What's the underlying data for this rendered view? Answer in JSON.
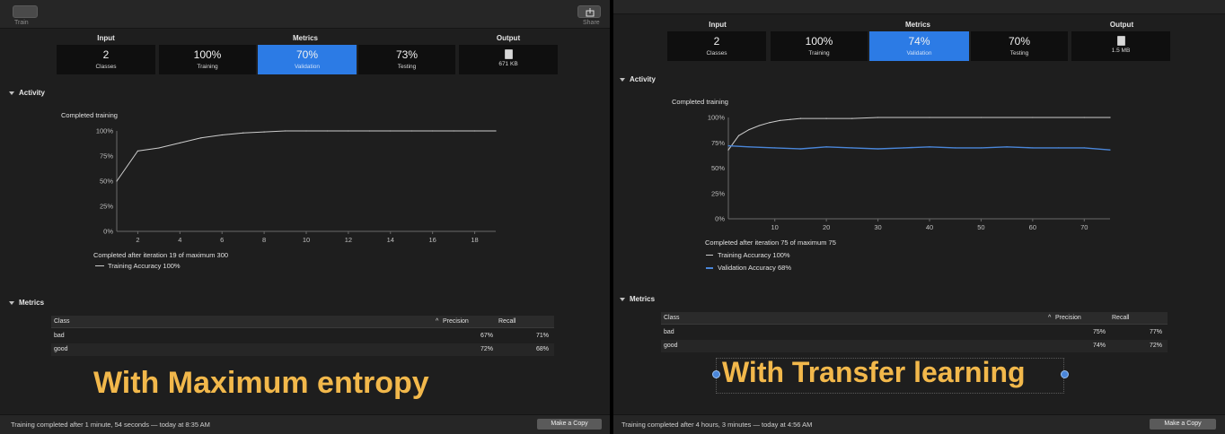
{
  "left": {
    "toolbar": {
      "train_label": "Train",
      "share_label": "Share"
    },
    "groups": {
      "input": "Input",
      "metrics": "Metrics",
      "output": "Output"
    },
    "tiles": {
      "classes": {
        "value": "2",
        "label": "Classes"
      },
      "training": {
        "value": "100%",
        "label": "Training"
      },
      "validation": {
        "value": "70%",
        "label": "Validation"
      },
      "testing": {
        "value": "73%",
        "label": "Testing"
      },
      "output": {
        "label": "671 KB",
        "icon": "model-file-icon"
      }
    },
    "activity": {
      "section_label": "Activity",
      "chart_title": "Completed training",
      "completed_text": "Completed after iteration 19 of maximum 300",
      "legend_training": "Training Accuracy 100%"
    },
    "metrics_table": {
      "section_label": "Metrics",
      "headers": {
        "class": "Class",
        "precision": "Precision",
        "recall": "Recall"
      },
      "rows": [
        {
          "class": "bad",
          "precision": "67%",
          "recall": "71%"
        },
        {
          "class": "good",
          "precision": "72%",
          "recall": "68%"
        }
      ]
    },
    "status": "Training completed after 1 minute, 54 seconds — today at 8:35 AM",
    "copy_button": "Make a Copy",
    "overlay": "With Maximum entropy"
  },
  "right": {
    "groups": {
      "input": "Input",
      "metrics": "Metrics",
      "output": "Output"
    },
    "tiles": {
      "classes": {
        "value": "2",
        "label": "Classes"
      },
      "training": {
        "value": "100%",
        "label": "Training"
      },
      "validation": {
        "value": "74%",
        "label": "Validation"
      },
      "testing": {
        "value": "70%",
        "label": "Testing"
      },
      "output": {
        "label": "1.5 MB",
        "icon": "model-file-icon"
      }
    },
    "activity": {
      "section_label": "Activity",
      "chart_title": "Completed training",
      "completed_text": "Completed after iteration 75 of maximum 75",
      "legend_training": "Training Accuracy 100%",
      "legend_validation": "Validation Accuracy 68%"
    },
    "metrics_table": {
      "section_label": "Metrics",
      "headers": {
        "class": "Class",
        "precision": "Precision",
        "recall": "Recall"
      },
      "rows": [
        {
          "class": "bad",
          "precision": "75%",
          "recall": "77%"
        },
        {
          "class": "good",
          "precision": "74%",
          "recall": "72%"
        }
      ]
    },
    "status": "Training completed after 4 hours, 3 minutes — today at 4:56 AM",
    "copy_button": "Make a Copy",
    "overlay": "With Transfer learning"
  },
  "colors": {
    "accent": "#2c7be5",
    "overlay_text": "#f2b84b",
    "validation_line": "#4a86d9",
    "training_line": "#cccccc"
  },
  "chart_data": [
    {
      "type": "line",
      "title": "Completed training",
      "xlabel": "",
      "ylabel": "",
      "xlim": [
        1,
        19
      ],
      "ylim": [
        0,
        100
      ],
      "x_ticks": [
        2,
        4,
        6,
        8,
        10,
        12,
        14,
        16,
        18
      ],
      "y_ticks": [
        "0%",
        "25%",
        "50%",
        "75%",
        "100%"
      ],
      "series": [
        {
          "name": "Training Accuracy 100%",
          "color": "#cccccc",
          "x": [
            1,
            2,
            3,
            4,
            5,
            6,
            7,
            8,
            9,
            10,
            11,
            12,
            13,
            14,
            15,
            16,
            17,
            18,
            19
          ],
          "values": [
            50,
            80,
            83,
            88,
            93,
            96,
            98,
            99,
            100,
            100,
            100,
            100,
            100,
            100,
            100,
            100,
            100,
            100,
            100
          ]
        }
      ]
    },
    {
      "type": "line",
      "title": "Completed training",
      "xlabel": "",
      "ylabel": "",
      "xlim": [
        1,
        75
      ],
      "ylim": [
        0,
        100
      ],
      "x_ticks": [
        10,
        20,
        30,
        40,
        50,
        60,
        70
      ],
      "y_ticks": [
        "0%",
        "25%",
        "50%",
        "75%",
        "100%"
      ],
      "series": [
        {
          "name": "Training Accuracy 100%",
          "color": "#cccccc",
          "x": [
            1,
            3,
            5,
            7,
            9,
            11,
            13,
            15,
            20,
            25,
            30,
            40,
            50,
            60,
            70,
            75
          ],
          "values": [
            68,
            82,
            88,
            92,
            95,
            97,
            98,
            99,
            99,
            99,
            100,
            100,
            100,
            100,
            100,
            100
          ]
        },
        {
          "name": "Validation Accuracy 68%",
          "color": "#4a86d9",
          "x": [
            1,
            5,
            10,
            15,
            20,
            25,
            30,
            35,
            40,
            45,
            50,
            55,
            60,
            65,
            70,
            75
          ],
          "values": [
            72,
            71,
            70,
            69,
            71,
            70,
            69,
            70,
            71,
            70,
            70,
            71,
            70,
            70,
            70,
            68
          ]
        }
      ]
    }
  ]
}
